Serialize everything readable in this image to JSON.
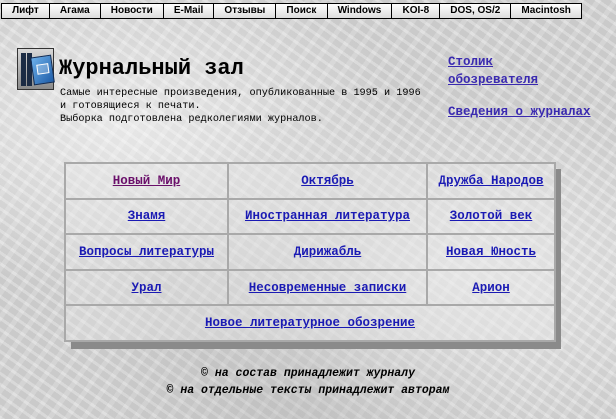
{
  "nav": [
    "Лифт",
    "Агама",
    "Новости",
    "E-Mail",
    "Отзывы",
    "Поиск",
    "Windows",
    "KOI-8",
    "DOS, OS/2",
    "Macintosh"
  ],
  "header": {
    "title": "Журнальный зал",
    "description": [
      "Самые интересные произведения, опубликованные в 1995 и 1996",
      "и готовящиеся к печати.",
      "Выборка подготовлена редколегиями журналов."
    ]
  },
  "side_links": {
    "reviewer": "Столик обозревателя",
    "journals_info": "Сведения о журналах"
  },
  "journals": [
    [
      "Новый Мир",
      "Октябрь",
      "Дружба Народов"
    ],
    [
      "Знамя",
      "Иностранная литература",
      "Золотой век"
    ],
    [
      "Вопросы литературы",
      "Дирижабль",
      "Новая Юность"
    ],
    [
      "Урал",
      "Несовременные записки",
      "Арион"
    ]
  ],
  "journal_full_row": "Новое литературное обозрение",
  "footer": [
    "© на состав принадлежит журналу",
    "© на отдельные тексты принадлежит авторам"
  ]
}
